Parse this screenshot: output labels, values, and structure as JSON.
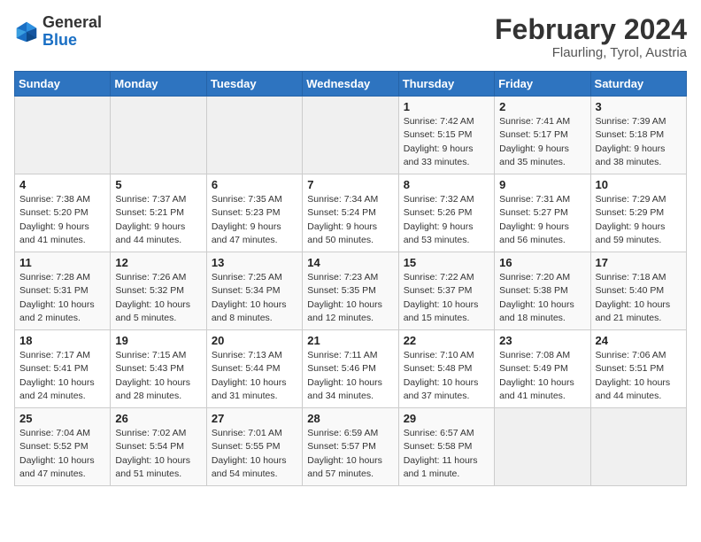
{
  "logo": {
    "general": "General",
    "blue": "Blue"
  },
  "header": {
    "title": "February 2024",
    "subtitle": "Flaurling, Tyrol, Austria"
  },
  "weekdays": [
    "Sunday",
    "Monday",
    "Tuesday",
    "Wednesday",
    "Thursday",
    "Friday",
    "Saturday"
  ],
  "weeks": [
    [
      {
        "day": "",
        "info": ""
      },
      {
        "day": "",
        "info": ""
      },
      {
        "day": "",
        "info": ""
      },
      {
        "day": "",
        "info": ""
      },
      {
        "day": "1",
        "info": "Sunrise: 7:42 AM\nSunset: 5:15 PM\nDaylight: 9 hours\nand 33 minutes."
      },
      {
        "day": "2",
        "info": "Sunrise: 7:41 AM\nSunset: 5:17 PM\nDaylight: 9 hours\nand 35 minutes."
      },
      {
        "day": "3",
        "info": "Sunrise: 7:39 AM\nSunset: 5:18 PM\nDaylight: 9 hours\nand 38 minutes."
      }
    ],
    [
      {
        "day": "4",
        "info": "Sunrise: 7:38 AM\nSunset: 5:20 PM\nDaylight: 9 hours\nand 41 minutes."
      },
      {
        "day": "5",
        "info": "Sunrise: 7:37 AM\nSunset: 5:21 PM\nDaylight: 9 hours\nand 44 minutes."
      },
      {
        "day": "6",
        "info": "Sunrise: 7:35 AM\nSunset: 5:23 PM\nDaylight: 9 hours\nand 47 minutes."
      },
      {
        "day": "7",
        "info": "Sunrise: 7:34 AM\nSunset: 5:24 PM\nDaylight: 9 hours\nand 50 minutes."
      },
      {
        "day": "8",
        "info": "Sunrise: 7:32 AM\nSunset: 5:26 PM\nDaylight: 9 hours\nand 53 minutes."
      },
      {
        "day": "9",
        "info": "Sunrise: 7:31 AM\nSunset: 5:27 PM\nDaylight: 9 hours\nand 56 minutes."
      },
      {
        "day": "10",
        "info": "Sunrise: 7:29 AM\nSunset: 5:29 PM\nDaylight: 9 hours\nand 59 minutes."
      }
    ],
    [
      {
        "day": "11",
        "info": "Sunrise: 7:28 AM\nSunset: 5:31 PM\nDaylight: 10 hours\nand 2 minutes."
      },
      {
        "day": "12",
        "info": "Sunrise: 7:26 AM\nSunset: 5:32 PM\nDaylight: 10 hours\nand 5 minutes."
      },
      {
        "day": "13",
        "info": "Sunrise: 7:25 AM\nSunset: 5:34 PM\nDaylight: 10 hours\nand 8 minutes."
      },
      {
        "day": "14",
        "info": "Sunrise: 7:23 AM\nSunset: 5:35 PM\nDaylight: 10 hours\nand 12 minutes."
      },
      {
        "day": "15",
        "info": "Sunrise: 7:22 AM\nSunset: 5:37 PM\nDaylight: 10 hours\nand 15 minutes."
      },
      {
        "day": "16",
        "info": "Sunrise: 7:20 AM\nSunset: 5:38 PM\nDaylight: 10 hours\nand 18 minutes."
      },
      {
        "day": "17",
        "info": "Sunrise: 7:18 AM\nSunset: 5:40 PM\nDaylight: 10 hours\nand 21 minutes."
      }
    ],
    [
      {
        "day": "18",
        "info": "Sunrise: 7:17 AM\nSunset: 5:41 PM\nDaylight: 10 hours\nand 24 minutes."
      },
      {
        "day": "19",
        "info": "Sunrise: 7:15 AM\nSunset: 5:43 PM\nDaylight: 10 hours\nand 28 minutes."
      },
      {
        "day": "20",
        "info": "Sunrise: 7:13 AM\nSunset: 5:44 PM\nDaylight: 10 hours\nand 31 minutes."
      },
      {
        "day": "21",
        "info": "Sunrise: 7:11 AM\nSunset: 5:46 PM\nDaylight: 10 hours\nand 34 minutes."
      },
      {
        "day": "22",
        "info": "Sunrise: 7:10 AM\nSunset: 5:48 PM\nDaylight: 10 hours\nand 37 minutes."
      },
      {
        "day": "23",
        "info": "Sunrise: 7:08 AM\nSunset: 5:49 PM\nDaylight: 10 hours\nand 41 minutes."
      },
      {
        "day": "24",
        "info": "Sunrise: 7:06 AM\nSunset: 5:51 PM\nDaylight: 10 hours\nand 44 minutes."
      }
    ],
    [
      {
        "day": "25",
        "info": "Sunrise: 7:04 AM\nSunset: 5:52 PM\nDaylight: 10 hours\nand 47 minutes."
      },
      {
        "day": "26",
        "info": "Sunrise: 7:02 AM\nSunset: 5:54 PM\nDaylight: 10 hours\nand 51 minutes."
      },
      {
        "day": "27",
        "info": "Sunrise: 7:01 AM\nSunset: 5:55 PM\nDaylight: 10 hours\nand 54 minutes."
      },
      {
        "day": "28",
        "info": "Sunrise: 6:59 AM\nSunset: 5:57 PM\nDaylight: 10 hours\nand 57 minutes."
      },
      {
        "day": "29",
        "info": "Sunrise: 6:57 AM\nSunset: 5:58 PM\nDaylight: 11 hours\nand 1 minute."
      },
      {
        "day": "",
        "info": ""
      },
      {
        "day": "",
        "info": ""
      }
    ]
  ]
}
